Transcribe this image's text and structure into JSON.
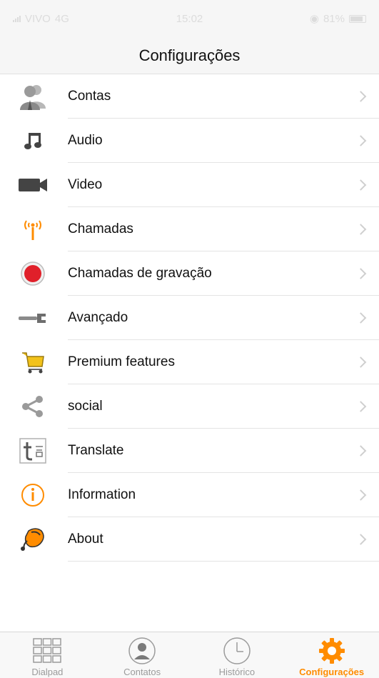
{
  "status": {
    "carrier": "VIVO",
    "network": "4G",
    "time": "15:02",
    "battery": "81%"
  },
  "nav": {
    "title": "Configurações"
  },
  "items": [
    {
      "label": "Contas",
      "icon": "account-icon"
    },
    {
      "label": "Audio",
      "icon": "music-note-icon"
    },
    {
      "label": "Video",
      "icon": "video-camera-icon"
    },
    {
      "label": "Chamadas",
      "icon": "antenna-icon"
    },
    {
      "label": "Chamadas de gravação",
      "icon": "record-icon"
    },
    {
      "label": "Avançado",
      "icon": "wrench-icon"
    },
    {
      "label": "Premium features",
      "icon": "shopping-cart-icon"
    },
    {
      "label": "social",
      "icon": "share-icon"
    },
    {
      "label": "Translate",
      "icon": "translate-icon"
    },
    {
      "label": "Information",
      "icon": "info-icon"
    },
    {
      "label": "About",
      "icon": "about-icon"
    }
  ],
  "tabs": [
    {
      "label": "Dialpad",
      "icon": "dialpad-icon"
    },
    {
      "label": "Contatos",
      "icon": "contacts-icon"
    },
    {
      "label": "Histórico",
      "icon": "clock-icon"
    },
    {
      "label": "Configurações",
      "icon": "gear-icon"
    }
  ],
  "colors": {
    "accent": "#ff8c00",
    "record": "#e0202a",
    "separator": "#e4e4e4"
  }
}
